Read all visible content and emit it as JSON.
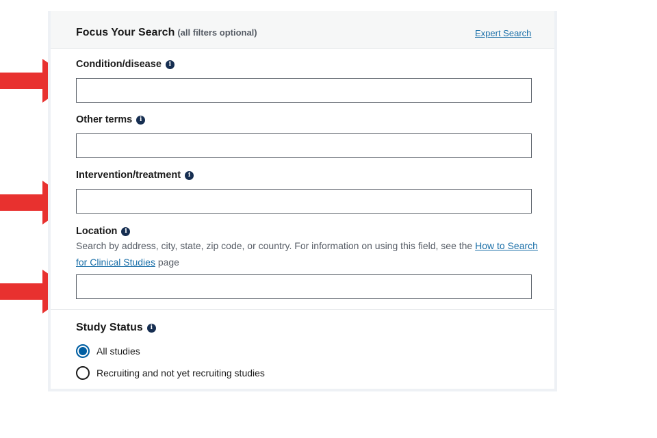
{
  "header": {
    "title": "Focus Your Search",
    "subtitle": "(all filters optional)",
    "expert_link": "Expert Search"
  },
  "fields": {
    "condition": {
      "label": "Condition/disease",
      "value": "",
      "placeholder": ""
    },
    "other_terms": {
      "label": "Other terms",
      "value": "",
      "placeholder": ""
    },
    "intervention": {
      "label": "Intervention/treatment",
      "value": "",
      "placeholder": ""
    },
    "location": {
      "label": "Location",
      "help_prefix": "Search by address, city, state, zip code, or country. For information on using this field, see the ",
      "help_link": "How to Search for Clinical Studies",
      "help_suffix": " page",
      "value": "",
      "placeholder": ""
    }
  },
  "study_status": {
    "title": "Study Status",
    "options": [
      {
        "label": "All studies",
        "checked": true
      },
      {
        "label": "Recruiting and not yet recruiting studies",
        "checked": false
      }
    ]
  },
  "icons": {
    "info": "info-icon",
    "annotation_arrow": "red-arrow-icon"
  },
  "colors": {
    "link": "#1a6fa8",
    "info_icon": "#162e51",
    "radio_checked": "#005ea2",
    "arrow": "#e8312f",
    "header_bg": "#f6f7f7"
  }
}
